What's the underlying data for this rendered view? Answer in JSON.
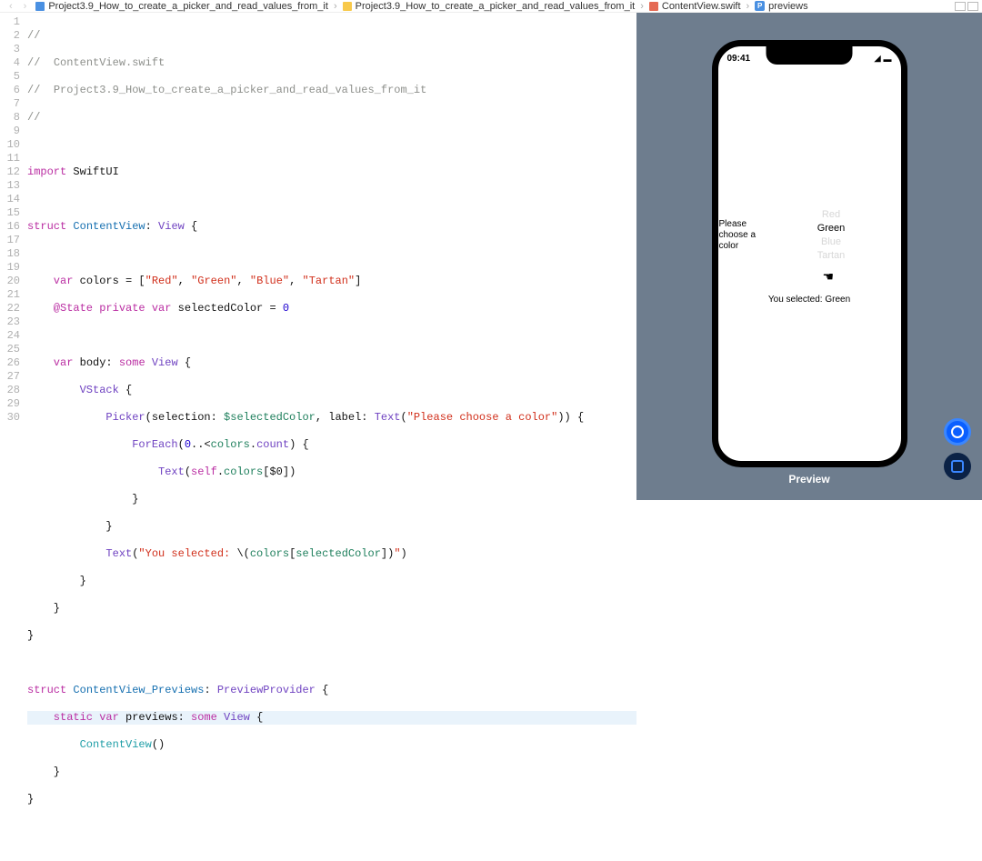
{
  "breadcrumb": {
    "item1": "Project3.9_How_to_create_a_picker_and_read_values_from_it",
    "item2": "Project3.9_How_to_create_a_picker_and_read_values_from_it",
    "item3": "ContentView.swift",
    "item4": "previews",
    "p_letter": "P"
  },
  "code": {
    "l1": "//",
    "l2a": "//  ",
    "l2b": "ContentView.swift",
    "l3a": "//  ",
    "l3b": "Project3.9_How_to_create_a_picker_and_read_values_from_it",
    "l4": "//",
    "l6a": "import",
    "l6b": " SwiftUI",
    "l8a": "struct",
    "l8b": " ContentView",
    "l8c": ": ",
    "l8d": "View",
    "l8e": " {",
    "l10a": "    var",
    "l10b": " colors = [",
    "l10c": "\"Red\"",
    "l10d": ", ",
    "l10e": "\"Green\"",
    "l10f": ", ",
    "l10g": "\"Blue\"",
    "l10h": ", ",
    "l10i": "\"Tartan\"",
    "l10j": "]",
    "l11a": "    @State",
    "l11b": " private",
    "l11c": " var",
    "l11d": " selectedColor = ",
    "l11e": "0",
    "l13a": "    var",
    "l13b": " body: ",
    "l13c": "some",
    "l13d": " View",
    "l13e": " {",
    "l14a": "        VStack",
    "l14b": " {",
    "l15a": "            Picker",
    "l15b": "(selection: ",
    "l15c": "$selectedColor",
    "l15d": ", label: ",
    "l15e": "Text",
    "l15f": "(",
    "l15g": "\"Please choose a color\"",
    "l15h": ")) {",
    "l16a": "                ForEach",
    "l16b": "(",
    "l16c": "0",
    "l16d": "..<",
    "l16e": "colors",
    "l16f": ".",
    "l16g": "count",
    "l16h": ") {",
    "l17a": "                    Text",
    "l17b": "(",
    "l17c": "self",
    "l17d": ".",
    "l17e": "colors",
    "l17f": "[$0])",
    "l18": "                }",
    "l19": "            }",
    "l20a": "            Text",
    "l20b": "(",
    "l20c": "\"You selected: ",
    "l20d": "\\(",
    "l20e": "colors",
    "l20f": "[",
    "l20g": "selectedColor",
    "l20h": "])",
    "l20i": "\"",
    "l20j": ")",
    "l21": "        }",
    "l22": "    }",
    "l23": "}",
    "l25a": "struct",
    "l25b": " ContentView_Previews",
    "l25c": ": ",
    "l25d": "PreviewProvider",
    "l25e": " {",
    "l26a": "    static",
    "l26b": " var",
    "l26c": " previews: ",
    "l26d": "some",
    "l26e": " View",
    "l26f": " {",
    "l27a": "        ContentView",
    "l27b": "()",
    "l28": "    }",
    "l29": "}"
  },
  "preview": {
    "time": "09:41",
    "picker_label": "Please choose a color",
    "options": {
      "o0": "Red",
      "o1": "Green",
      "o2": "Blue",
      "o3": "Tartan"
    },
    "selected_text": "You selected: Green",
    "title": "Preview"
  },
  "line_numbers": [
    "1",
    "2",
    "3",
    "4",
    "5",
    "6",
    "7",
    "8",
    "9",
    "10",
    "11",
    "12",
    "13",
    "14",
    "15",
    "16",
    "17",
    "18",
    "19",
    "20",
    "21",
    "22",
    "23",
    "24",
    "25",
    "26",
    "27",
    "28",
    "29",
    "30"
  ]
}
